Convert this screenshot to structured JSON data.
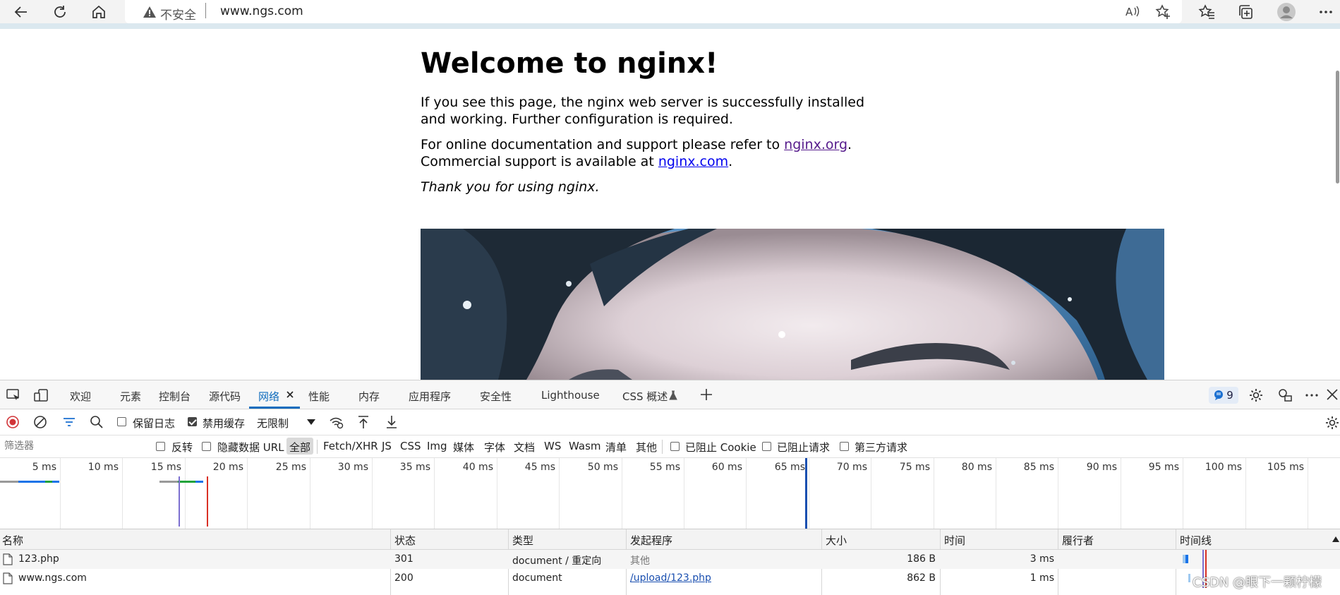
{
  "browser": {
    "security_label": "不安全",
    "url": "www.ngs.com"
  },
  "page": {
    "heading": "Welcome to nginx!",
    "para1": "If you see this page, the nginx web server is successfully installed and working. Further configuration is required.",
    "para2_prefix": "For online documentation and support please refer to ",
    "link1": "nginx.org",
    "para2_mid": ".",
    "para2_line2_prefix": "Commercial support is available at ",
    "link2": "nginx.com",
    "para2_suffix": ".",
    "para3": "Thank you for using nginx."
  },
  "devtools": {
    "tabs": [
      "欢迎",
      "元素",
      "控制台",
      "源代码",
      "网络",
      "性能",
      "内存",
      "应用程序",
      "安全性",
      "Lighthouse",
      "CSS 概述"
    ],
    "active_tab": "网络",
    "issues_count": "9",
    "toolbar": {
      "preserve_log": "保留日志",
      "disable_cache": "禁用缓存",
      "throttle": "无限制"
    },
    "filter": {
      "placeholder": "筛选器",
      "invert": "反转",
      "hide_data_url": "隐藏数据 URL",
      "types": [
        "全部",
        "Fetch/XHR",
        "JS",
        "CSS",
        "Img",
        "媒体",
        "字体",
        "文档",
        "WS",
        "Wasm",
        "清单",
        "其他"
      ],
      "blocked_cookies": "已阻止 Cookie",
      "blocked_requests": "已阻止请求",
      "third_party": "第三方请求"
    },
    "overview_ticks": [
      "5 ms",
      "10 ms",
      "15 ms",
      "20 ms",
      "25 ms",
      "30 ms",
      "35 ms",
      "40 ms",
      "45 ms",
      "50 ms",
      "55 ms",
      "60 ms",
      "65 ms",
      "70 ms",
      "75 ms",
      "80 ms",
      "85 ms",
      "90 ms",
      "95 ms",
      "100 ms",
      "105 ms"
    ],
    "columns": [
      "名称",
      "状态",
      "类型",
      "发起程序",
      "大小",
      "时间",
      "履行者",
      "时间线"
    ],
    "rows": [
      {
        "name": "123.php",
        "status": "301",
        "type": "document / 重定向",
        "initiator": "其他",
        "size": "186 B",
        "time": "3 ms",
        "fulfilled_by": ""
      },
      {
        "name": "www.ngs.com",
        "status": "200",
        "type": "document",
        "initiator": "/upload/123.php",
        "size": "862 B",
        "time": "1 ms",
        "fulfilled_by": ""
      }
    ]
  },
  "watermark": "CSDN @眼下一颗柠檬"
}
